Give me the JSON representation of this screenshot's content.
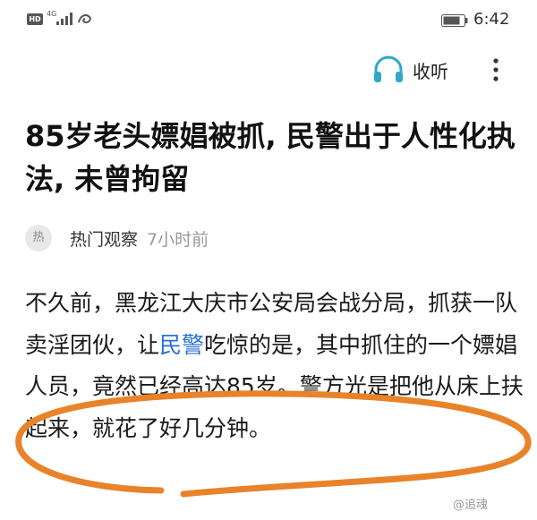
{
  "status_bar": {
    "hd_badge": "HD",
    "network": "4G",
    "time": "6:42"
  },
  "toolbar": {
    "listen_label": "收听",
    "listen_icon": "headphones-icon",
    "more_icon": "more-vertical-icon"
  },
  "article": {
    "title": "85岁老头嫖娼被抓, 民警出于人性化执法, 未曾拘留",
    "source_avatar": "热",
    "source_name": "热门观察",
    "publish_time": "7小时前",
    "body_before_link": "不久前，黑龙江大庆市公安局会战分局，抓获一队卖淫团伙，让",
    "body_link": "民警",
    "body_after_link": "吃惊的是，其中抓住的一个嫖娼人员，竟然已经高达85岁。警方光是把他从床上扶起来，就花了好几分钟。"
  },
  "annotation": {
    "color": "#e8832a"
  },
  "watermark": {
    "text": "@追魂"
  }
}
